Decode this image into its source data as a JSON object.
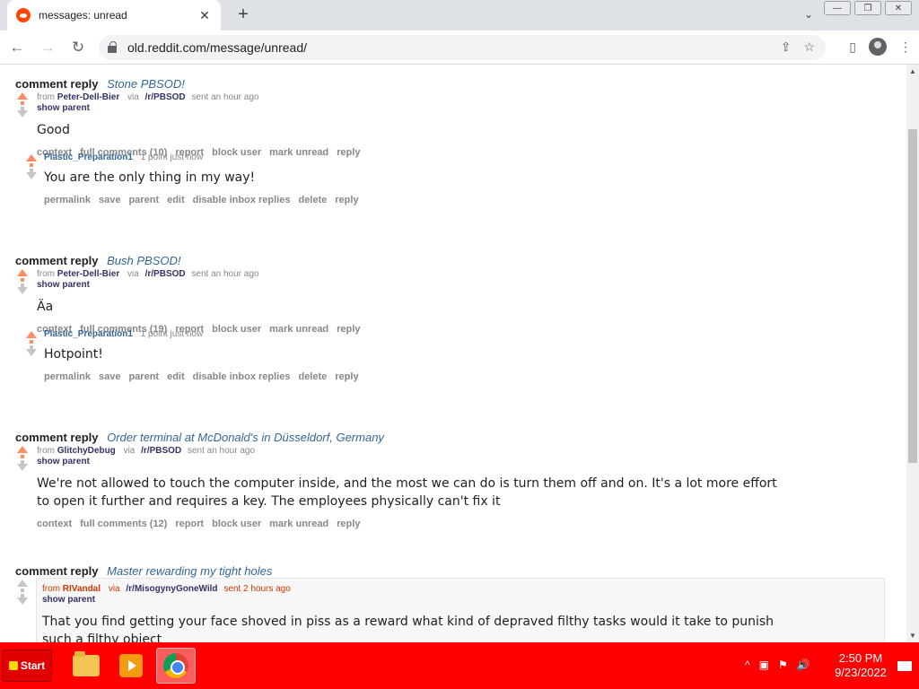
{
  "browser": {
    "tab_title": "messages: unread",
    "tab_close": "✕",
    "new_tab": "+",
    "tab_search": "⌄",
    "url": "old.reddit.com/message/unread/",
    "win_minimize": "—",
    "win_restore": "❐",
    "win_close": "✕",
    "back": "←",
    "forward": "→",
    "reload": "↻",
    "share": "⇪",
    "star": "☆",
    "sidepanel": "▯",
    "menu": "⋮"
  },
  "entries": [
    {
      "type": "comment reply",
      "title": "Stone PBSOD!",
      "from_label": "from",
      "author": "Peter-Dell-Bier",
      "via": "via",
      "subreddit": "/r/PBSOD",
      "sent": "sent an hour ago",
      "show_parent": "show parent",
      "body": "Good",
      "buttons": [
        "context",
        "full comments (10)",
        "report",
        "block user",
        "mark unread",
        "reply"
      ],
      "reply": {
        "author": "Plastic_Preparation1",
        "score": "1 point just now",
        "body": "You are the only thing in my way!",
        "buttons": [
          "permalink",
          "save",
          "parent",
          "edit",
          "disable inbox replies",
          "delete",
          "reply"
        ]
      }
    },
    {
      "type": "comment reply",
      "title": "Bush PBSOD!",
      "from_label": "from",
      "author": "Peter-Dell-Bier",
      "via": "via",
      "subreddit": "/r/PBSOD",
      "sent": "sent an hour ago",
      "show_parent": "show parent",
      "body": "Äa",
      "buttons": [
        "context",
        "full comments (19)",
        "report",
        "block user",
        "mark unread",
        "reply"
      ],
      "reply": {
        "author": "Plastic_Preparation1",
        "score": "1 point just now",
        "body": "Hotpoint!",
        "buttons": [
          "permalink",
          "save",
          "parent",
          "edit",
          "disable inbox replies",
          "delete",
          "reply"
        ]
      }
    },
    {
      "type": "comment reply",
      "title": "Order terminal at McDonald's in Düsseldorf, Germany",
      "from_label": "from",
      "author": "GlitchyDebug",
      "via": "via",
      "subreddit": "/r/PBSOD",
      "sent": "sent an hour ago",
      "show_parent": "show parent",
      "body_line1": "We're not allowed to touch the computer inside, and the most we can do is turn them off and on. It's a lot more effort",
      "body_line2": "to open it further and requires a key. The employees physically can't fix it",
      "buttons": [
        "context",
        "full comments (12)",
        "report",
        "block user",
        "mark unread",
        "reply"
      ]
    },
    {
      "type": "comment reply",
      "title": "Master rewarding my tight holes",
      "from_label": "from",
      "author": "RIVandal",
      "via": "via",
      "subreddit": "/r/MisogynyGoneWild",
      "sent": "sent 2 hours ago",
      "show_parent": "show parent",
      "body_line1": "That you find getting your face shoved in piss as a reward what kind of depraved filthy tasks would it take to punish",
      "body_line2": "such a filthy object"
    }
  ],
  "taskbar": {
    "start_label": "Start",
    "tray_up": "^",
    "tray_network": "▣",
    "tray_flag": "⚑",
    "tray_volume": "🔊",
    "time": "2:50 PM",
    "date": "9/23/2022"
  },
  "colors": {
    "taskbar": "#ff0000",
    "link": "#336699",
    "upvote": "#ff8b60"
  }
}
